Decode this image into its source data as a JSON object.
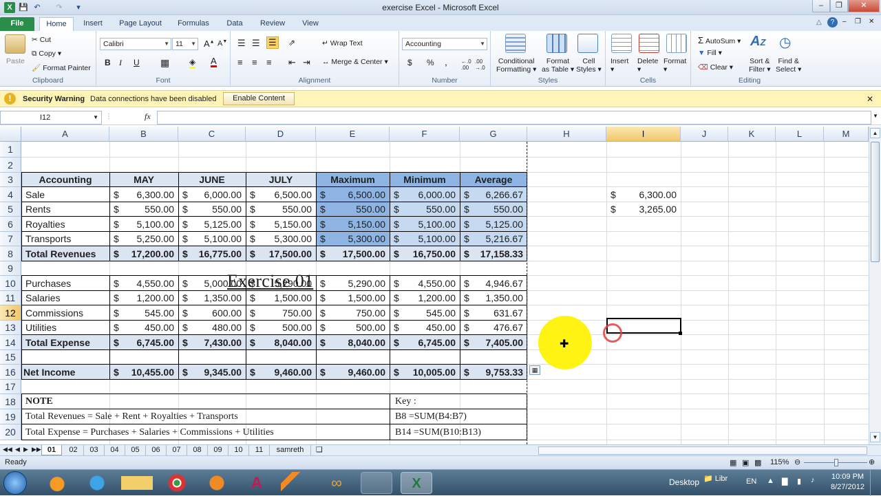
{
  "window": {
    "title": "exercise Excel  -  Microsoft Excel"
  },
  "tabs": [
    "File",
    "Home",
    "Insert",
    "Page Layout",
    "Formulas",
    "Data",
    "Review",
    "View"
  ],
  "clipboard": {
    "paste": "Paste",
    "cut": "Cut",
    "copy": "Copy",
    "format_painter": "Format Painter",
    "label": "Clipboard"
  },
  "font": {
    "name": "Calibri",
    "size": "11",
    "bold": "B",
    "italic": "I",
    "underline": "U",
    "label": "Font"
  },
  "alignment": {
    "wrap": "Wrap Text",
    "merge": "Merge & Center",
    "label": "Alignment"
  },
  "number": {
    "format": "Accounting",
    "currency": "$",
    "percent": "%",
    "comma": ",",
    "label": "Number"
  },
  "styles": {
    "conditional": "Conditional",
    "conditional2": "Formatting",
    "format_table": "Format",
    "format_table2": "as Table",
    "cell_styles": "Cell",
    "cell_styles2": "Styles",
    "label": "Styles"
  },
  "cells": {
    "insert": "Insert",
    "delete": "Delete",
    "format": "Format",
    "label": "Cells"
  },
  "editing": {
    "autosum": "AutoSum",
    "fill": "Fill",
    "clear": "Clear",
    "sort": "Sort &",
    "sort2": "Filter",
    "find": "Find &",
    "find2": "Select",
    "label": "Editing"
  },
  "security": {
    "title": "Security Warning",
    "message": "Data connections have been disabled",
    "button": "Enable Content"
  },
  "formula_bar": {
    "name_box": "I12",
    "fx": "fx",
    "value": ""
  },
  "columns": [
    "A",
    "B",
    "C",
    "D",
    "E",
    "F",
    "G",
    "H",
    "I",
    "J",
    "K",
    "L",
    "M"
  ],
  "rows": [
    "1",
    "2",
    "3",
    "4",
    "5",
    "6",
    "7",
    "8",
    "9",
    "10",
    "11",
    "12",
    "13",
    "14",
    "15",
    "16",
    "17",
    "18",
    "19",
    "20"
  ],
  "sheet": {
    "title": "Exercise 01",
    "header": [
      "Accounting",
      "MAY",
      "JUNE",
      "JULY",
      "Maximum",
      "Minimum",
      "Average"
    ],
    "revenues": [
      [
        "Sale",
        "6,300.00",
        "6,000.00",
        "6,500.00",
        "6,500.00",
        "6,000.00",
        "6,266.67"
      ],
      [
        "Rents",
        "550.00",
        "550.00",
        "550.00",
        "550.00",
        "550.00",
        "550.00"
      ],
      [
        "Royalties",
        "5,100.00",
        "5,125.00",
        "5,150.00",
        "5,150.00",
        "5,100.00",
        "5,125.00"
      ],
      [
        "Transports",
        "5,250.00",
        "5,100.00",
        "5,300.00",
        "5,300.00",
        "5,100.00",
        "5,216.67"
      ]
    ],
    "total_revenues": [
      "Total Revenues",
      "17,200.00",
      "16,775.00",
      "17,500.00",
      "17,500.00",
      "16,750.00",
      "17,158.33"
    ],
    "expenses": [
      [
        "Purchases",
        "4,550.00",
        "5,000.00",
        "5,290.00",
        "5,290.00",
        "4,550.00",
        "4,946.67"
      ],
      [
        "Salaries",
        "1,200.00",
        "1,350.00",
        "1,500.00",
        "1,500.00",
        "1,200.00",
        "1,350.00"
      ],
      [
        "Commissions",
        "545.00",
        "600.00",
        "750.00",
        "750.00",
        "545.00",
        "631.67"
      ],
      [
        "Utilities",
        "450.00",
        "480.00",
        "500.00",
        "500.00",
        "450.00",
        "476.67"
      ]
    ],
    "total_expense": [
      "Total Expense",
      "6,745.00",
      "7,430.00",
      "8,040.00",
      "8,040.00",
      "6,745.00",
      "7,405.00"
    ],
    "net_income": [
      "Net Income",
      "10,455.00",
      "9,345.00",
      "9,460.00",
      "9,460.00",
      "10,005.00",
      "9,753.33"
    ],
    "currency": "$",
    "i4": "6,300.00",
    "i5": "3,265.00",
    "note": "NOTE",
    "note_19": "Total Revenues =  Sale + Rent + Royalties + Transports",
    "key": "Key :",
    "key_19": "B8  =SUM(B4:B7)",
    "row20_partial": "Total Expense =  Purchases + Salaries + Commissions + Utilities",
    "key_20_partial": "B14  =SUM(B10:B13)"
  },
  "sheet_tabs": [
    "01",
    "02",
    "03",
    "04",
    "05",
    "06",
    "07",
    "08",
    "09",
    "10",
    "11",
    "samreth"
  ],
  "status": {
    "ready": "Ready",
    "zoom": "115%"
  },
  "taskbar": {
    "desktop": "Desktop",
    "libr": "Libr",
    "lang": "EN",
    "time": "10:09 PM",
    "date": "8/27/2012"
  },
  "colors": {
    "file_tab": "#2a8d4a",
    "selected_blue": "#8db4e3",
    "light_blue": "#dbe5f1",
    "highlight": "#fff200"
  }
}
